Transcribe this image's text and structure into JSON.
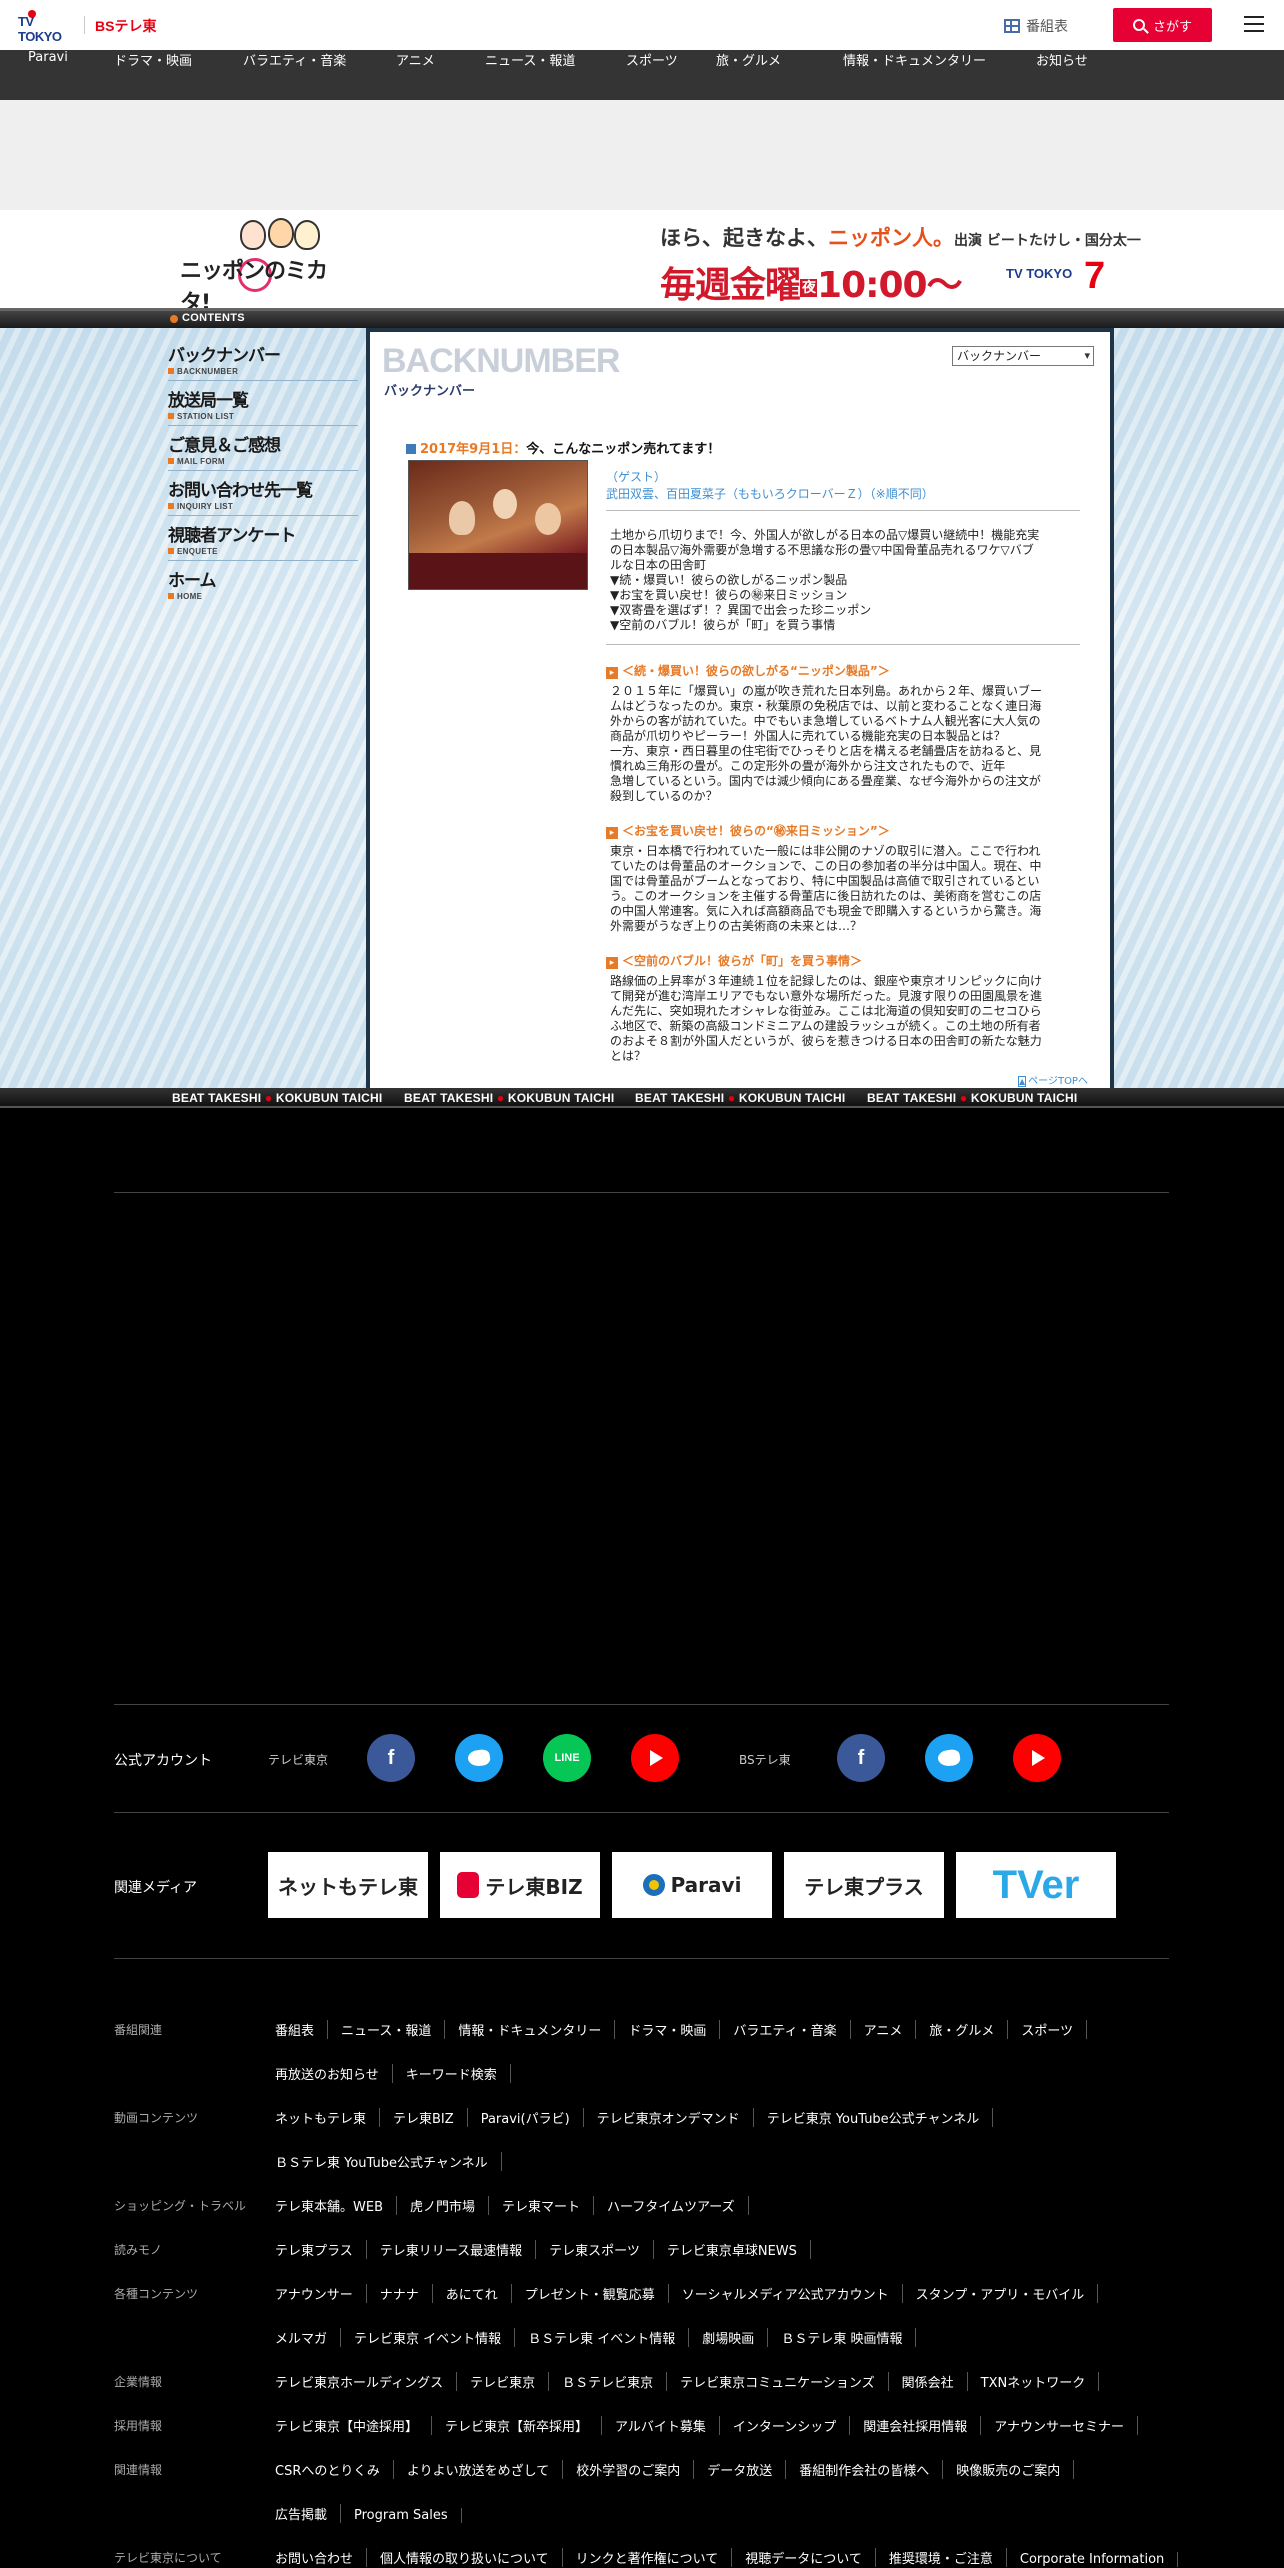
{
  "header": {
    "tv_logo_text": "TV TOKYO",
    "bs_logo_text": "BSテレ東",
    "tv_guide_label": "番組表",
    "search_label": "さがす"
  },
  "category_nav": [
    "Paravi",
    "ドラマ・映画",
    "バラエティ・音楽",
    "アニメ",
    "ニュース・報道",
    "スポーツ",
    "旅・グルメ",
    "情報・ドキュメンタリー",
    "お知らせ"
  ],
  "banner": {
    "program_logo": "ニッポンのミカタ!",
    "line1_a": "ほら、起きなよ、",
    "line1_b": "ニッポン人。",
    "line1_c": "出演 ビートたけし・国分太一",
    "line2_a": "毎週金曜",
    "line2_b": "夜",
    "line2_c": "10:00〜",
    "network_mark": "TV TOKYO"
  },
  "contents_label": "CONTENTS",
  "sidenav": [
    {
      "jp": "バックナンバー",
      "en": "BACKNUMBER"
    },
    {
      "jp": "放送局一覧",
      "en": "STATION LIST"
    },
    {
      "jp": "ご意見＆ご感想",
      "en": "MAIL FORM"
    },
    {
      "jp": "お問い合わせ先一覧",
      "en": "INQUIRY LIST"
    },
    {
      "jp": "視聴者アンケート",
      "en": "ENQUETE"
    },
    {
      "jp": "ホーム",
      "en": "HOME"
    }
  ],
  "backnumber": {
    "title_en": "BACKNUMBER",
    "title_jp": "バックナンバー",
    "select_value": "バックナンバー",
    "episode_date": "2017年9月1日：",
    "episode_title": "今、こんなニッポン売れてます！",
    "guest_label": "（ゲスト）",
    "guest_names": "武田双雲、百田夏菜子（ももいろクローバーＺ）（※順不同）",
    "summary_lines": [
      "土地から爪切りまで！今、外国人が欲しがる日本の品▽爆買い継続中！機能充実",
      "の日本製品▽海外需要が急増する不思議な形の畳▽中国骨董品売れるワケ▽バブ",
      "ルな日本の田舎町",
      "▼続・爆買い！彼らの欲しがるニッポン製品",
      "▼お宝を買い戻せ！彼らの㊙来日ミッション",
      "▼双寄畳を選ばず！？異国で出会った珍ニッポン",
      "▼空前のバブル！彼らが「町」を買う事情"
    ],
    "sections": [
      {
        "heading": "＜続・爆買い！彼らの欲しがる“ニッポン製品”＞",
        "body": [
          "２０１５年に「爆買い」の嵐が吹き荒れた日本列島。あれから２年、爆買いブー",
          "ムはどうなったのか。東京・秋葉原の免税店では、以前と変わることなく連日海",
          "外からの客が訪れていた。中でもいま急増しているベトナム人観光客に大人気の",
          "商品が爪切りやピーラー！外国人に売れている機能充実の日本製品とは？",
          "一方、東京・西日暮里の住宅街でひっそりと店を構える老舗畳店を訪ねると、見",
          "慣れぬ三角形の畳が。この定形外の畳が海外から注文されたもので、近年",
          "急増しているという。国内では減少傾向にある畳産業、なぜ今海外からの注文が",
          "殺到しているのか？"
        ]
      },
      {
        "heading": "＜お宝を買い戻せ！彼らの“㊙来日ミッション”＞",
        "body": [
          "東京・日本橋で行われていた一般には非公開のナゾの取引に潜入。ここで行われ",
          "ていたのは骨董品のオークションで、この日の参加者の半分は中国人。現在、中",
          "国では骨董品がブームとなっており、特に中国製品は高値で取引されているとい",
          "う。このオークションを主催する骨董店に後日訪れたのは、美術商を営むこの店",
          "の中国人常連客。気に入れば高額商品でも現金で即購入するというから驚き。海",
          "外需要がうなぎ上りの古美術商の未来とは…？"
        ]
      },
      {
        "heading": "＜空前のバブル！彼らが「町」を買う事情＞",
        "body": [
          "路線価の上昇率が３年連続１位を記録したのは、銀座や東京オリンピックに向け",
          "て開発が進む湾岸エリアでもない意外な場所だった。見渡す限りの田園風景を進",
          "んだ先に、突如現れたオシャレな街並み。ここは北海道の倶知安町のニセコひら",
          "ふ地区で、新築の高級コンドミニアムの建設ラッシュが続く。この土地の所有者",
          "のおよそ８割が外国人だというが、彼らを惹きつける日本の田舎町の新たな魅力",
          "とは？"
        ]
      }
    ],
    "page_top": "ページTOPへ"
  },
  "ticker": {
    "name1": "BEAT TAKESHI",
    "name2": "KOKUBUN TAICHI"
  },
  "footer": {
    "official_accounts_label": "公式アカウント",
    "tvt_label": "テレビ東京",
    "bs_label": "BSテレ東",
    "related_media_label": "関連メディア",
    "media": [
      "ネットもテレ東",
      "テレ東BIZ",
      "Paravi",
      "テレ東プラス",
      "TVer"
    ],
    "rows": [
      {
        "label": "番組関連",
        "links": [
          "番組表",
          "ニュース・報道",
          "情報・ドキュメンタリー",
          "ドラマ・映画",
          "バラエティ・音楽",
          "アニメ",
          "旅・グルメ",
          "スポーツ"
        ]
      },
      {
        "label": "",
        "links": [
          "再放送のお知らせ",
          "キーワード検索"
        ]
      },
      {
        "label": "動画コンテンツ",
        "links": [
          "ネットもテレ東",
          "テレ東BIZ",
          "Paravi(パラビ)",
          "テレビ東京オンデマンド",
          "テレビ東京 YouTube公式チャンネル"
        ]
      },
      {
        "label": "",
        "links": [
          "ＢＳテレ東 YouTube公式チャンネル"
        ]
      },
      {
        "label": "ショッピング・トラベル",
        "links": [
          "テレ東本舗。WEB",
          "虎ノ門市場",
          "テレ東マート",
          "ハーフタイムツアーズ"
        ]
      },
      {
        "label": "読みモノ",
        "links": [
          "テレ東プラス",
          "テレ東リリース最速情報",
          "テレ東スポーツ",
          "テレビ東京卓球NEWS"
        ]
      },
      {
        "label": "各種コンテンツ",
        "links": [
          "アナウンサー",
          "ナナナ",
          "あにてれ",
          "プレゼント・観覧応募",
          "ソーシャルメディア公式アカウント",
          "スタンプ・アプリ・モバイル"
        ]
      },
      {
        "label": "",
        "links": [
          "メルマガ",
          "テレビ東京 イベント情報",
          "ＢＳテレ東 イベント情報",
          "劇場映画",
          "ＢＳテレ東 映画情報"
        ]
      },
      {
        "label": "企業情報",
        "links": [
          "テレビ東京ホールディングス",
          "テレビ東京",
          "ＢＳテレビ東京",
          "テレビ東京コミュニケーションズ",
          "関係会社",
          "TXNネットワーク"
        ]
      },
      {
        "label": "採用情報",
        "links": [
          "テレビ東京【中途採用】",
          "テレビ東京【新卒採用】",
          "アルバイト募集",
          "インターンシップ",
          "関連会社採用情報",
          "アナウンサーセミナー"
        ]
      },
      {
        "label": "関連情報",
        "links": [
          "CSRへのとりくみ",
          "よりよい放送をめざして",
          "校外学習のご案内",
          "データ放送",
          "番組制作会社の皆様へ",
          "映像販売のご案内"
        ]
      },
      {
        "label": "",
        "links": [
          "広告掲載",
          "Program Sales"
        ]
      },
      {
        "label": "テレビ東京について",
        "links": [
          "お問い合わせ",
          "個人情報の取り扱いについて",
          "リンクと著作権について",
          "視聴データについて",
          "推奨環境・ご注意",
          "Corporate Information"
        ]
      }
    ]
  },
  "colors": {
    "accent_red": "#e60033",
    "orange": "#e87a26",
    "link_blue": "#3f8fd2",
    "nav_bg": "#343434"
  }
}
